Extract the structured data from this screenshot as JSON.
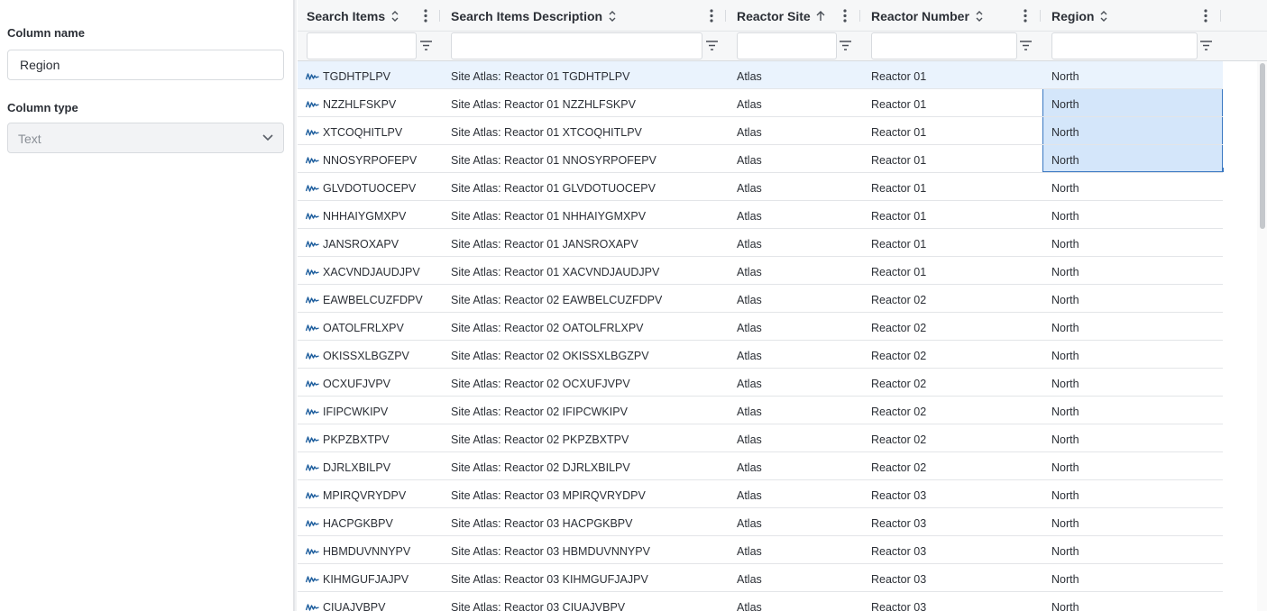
{
  "panel": {
    "column_name_label": "Column name",
    "column_name_value": "Region",
    "column_type_label": "Column type",
    "column_type_value": "Text"
  },
  "grid": {
    "columns": [
      {
        "title": "Search Items",
        "sort": "unsorted"
      },
      {
        "title": "Search Items Description",
        "sort": "unsorted"
      },
      {
        "title": "Reactor Site",
        "sort": "ascending"
      },
      {
        "title": "Reactor Number",
        "sort": "unsorted"
      },
      {
        "title": "Region",
        "sort": "unsorted"
      }
    ],
    "selected_rows": [
      0,
      1,
      2,
      3
    ],
    "rows": [
      {
        "item": "TGDHTPLPV",
        "desc": "Site Atlas: Reactor 01 TGDHTPLPV",
        "site": "Atlas",
        "number": "Reactor 01",
        "region": "North"
      },
      {
        "item": "NZZHLFSKPV",
        "desc": "Site Atlas: Reactor 01 NZZHLFSKPV",
        "site": "Atlas",
        "number": "Reactor 01",
        "region": "North"
      },
      {
        "item": "XTCOQHITLPV",
        "desc": "Site Atlas: Reactor 01 XTCOQHITLPV",
        "site": "Atlas",
        "number": "Reactor 01",
        "region": "North"
      },
      {
        "item": "NNOSYRPOFEPV",
        "desc": "Site Atlas: Reactor 01 NNOSYRPOFEPV",
        "site": "Atlas",
        "number": "Reactor 01",
        "region": "North"
      },
      {
        "item": "GLVDOTUOCEPV",
        "desc": "Site Atlas: Reactor 01 GLVDOTUOCEPV",
        "site": "Atlas",
        "number": "Reactor 01",
        "region": "North"
      },
      {
        "item": "NHHAIYGMXPV",
        "desc": "Site Atlas: Reactor 01 NHHAIYGMXPV",
        "site": "Atlas",
        "number": "Reactor 01",
        "region": "North"
      },
      {
        "item": "JANSROXAPV",
        "desc": "Site Atlas: Reactor 01 JANSROXAPV",
        "site": "Atlas",
        "number": "Reactor 01",
        "region": "North"
      },
      {
        "item": "XACVNDJAUDJPV",
        "desc": "Site Atlas: Reactor 01 XACVNDJAUDJPV",
        "site": "Atlas",
        "number": "Reactor 01",
        "region": "North"
      },
      {
        "item": "EAWBELCUZFDPV",
        "desc": "Site Atlas: Reactor 02 EAWBELCUZFDPV",
        "site": "Atlas",
        "number": "Reactor 02",
        "region": "North"
      },
      {
        "item": "OATOLFRLXPV",
        "desc": "Site Atlas: Reactor 02 OATOLFRLXPV",
        "site": "Atlas",
        "number": "Reactor 02",
        "region": "North"
      },
      {
        "item": "OKISSXLBGZPV",
        "desc": "Site Atlas: Reactor 02 OKISSXLBGZPV",
        "site": "Atlas",
        "number": "Reactor 02",
        "region": "North"
      },
      {
        "item": "OCXUFJVPV",
        "desc": "Site Atlas: Reactor 02 OCXUFJVPV",
        "site": "Atlas",
        "number": "Reactor 02",
        "region": "North"
      },
      {
        "item": "IFIPCWKIPV",
        "desc": "Site Atlas: Reactor 02 IFIPCWKIPV",
        "site": "Atlas",
        "number": "Reactor 02",
        "region": "North"
      },
      {
        "item": "PKPZBXTPV",
        "desc": "Site Atlas: Reactor 02 PKPZBXTPV",
        "site": "Atlas",
        "number": "Reactor 02",
        "region": "North"
      },
      {
        "item": "DJRLXBILPV",
        "desc": "Site Atlas: Reactor 02 DJRLXBILPV",
        "site": "Atlas",
        "number": "Reactor 02",
        "region": "North"
      },
      {
        "item": "MPIRQVRYDPV",
        "desc": "Site Atlas: Reactor 03 MPIRQVRYDPV",
        "site": "Atlas",
        "number": "Reactor 03",
        "region": "North"
      },
      {
        "item": "HACPGKBPV",
        "desc": "Site Atlas: Reactor 03 HACPGKBPV",
        "site": "Atlas",
        "number": "Reactor 03",
        "region": "North"
      },
      {
        "item": "HBMDUVNNYPV",
        "desc": "Site Atlas: Reactor 03 HBMDUVNNYPV",
        "site": "Atlas",
        "number": "Reactor 03",
        "region": "North"
      },
      {
        "item": "KIHMGUFJAJPV",
        "desc": "Site Atlas: Reactor 03 KIHMGUFJAJPV",
        "site": "Atlas",
        "number": "Reactor 03",
        "region": "North"
      },
      {
        "item": "CIUAJVBPV",
        "desc": "Site Atlas: Reactor 03 CIUAJVBPV",
        "site": "Atlas",
        "number": "Reactor 03",
        "region": "North"
      }
    ]
  },
  "icons": {
    "row_icon": "signal-waveform-icon",
    "sort_unsorted": "sort-updown-icon",
    "sort_ascending": "arrow-up-icon",
    "column_menu": "vertical-dots-icon",
    "filter": "filter-icon",
    "select_chevron": "chevron-down-icon"
  },
  "colors": {
    "selection_fill": "#d4e6fa",
    "selection_border": "#3a78c2",
    "row_icon": "#1f5f9e"
  }
}
